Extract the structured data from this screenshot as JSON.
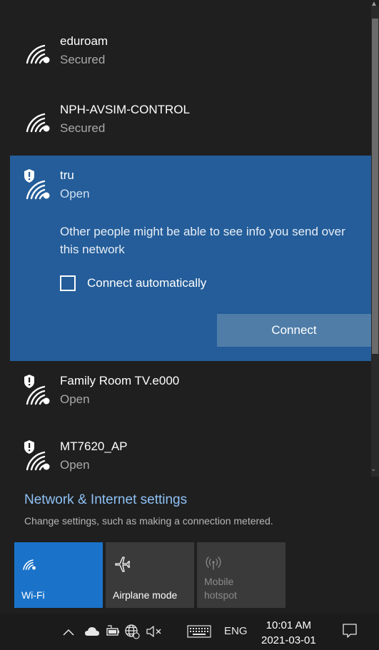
{
  "networks": [
    {
      "name": "eduroam",
      "status": "Secured",
      "secure": true
    },
    {
      "name": "NPH-AVSIM-CONTROL",
      "status": "Secured",
      "secure": true
    },
    {
      "name": "tru",
      "status": "Open",
      "secure": false,
      "expanded": true,
      "warning": "Other people might be able to see info you send over this network",
      "auto_label": "Connect automatically",
      "auto_checked": false,
      "connect_label": "Connect"
    },
    {
      "name": "Family Room TV.e000",
      "status": "Open",
      "secure": false
    },
    {
      "name": "MT7620_AP",
      "status": "Open",
      "secure": false
    }
  ],
  "settings": {
    "title": "Network & Internet settings",
    "subtitle": "Change settings, such as making a connection metered."
  },
  "tiles": [
    {
      "label": "Wi-Fi",
      "icon": "wifi-icon",
      "state": "on"
    },
    {
      "label": "Airplane mode",
      "icon": "airplane-icon",
      "state": "off"
    },
    {
      "label": "Mobile\nhotspot",
      "icon": "hotspot-icon",
      "state": "disabled"
    }
  ],
  "taskbar": {
    "language": "ENG",
    "time": "10:01 AM",
    "date": "2021-03-01"
  },
  "colors": {
    "expanded_bg": "#245d99",
    "wifi_tile": "#1a73c9",
    "link": "#8ec1f5"
  }
}
